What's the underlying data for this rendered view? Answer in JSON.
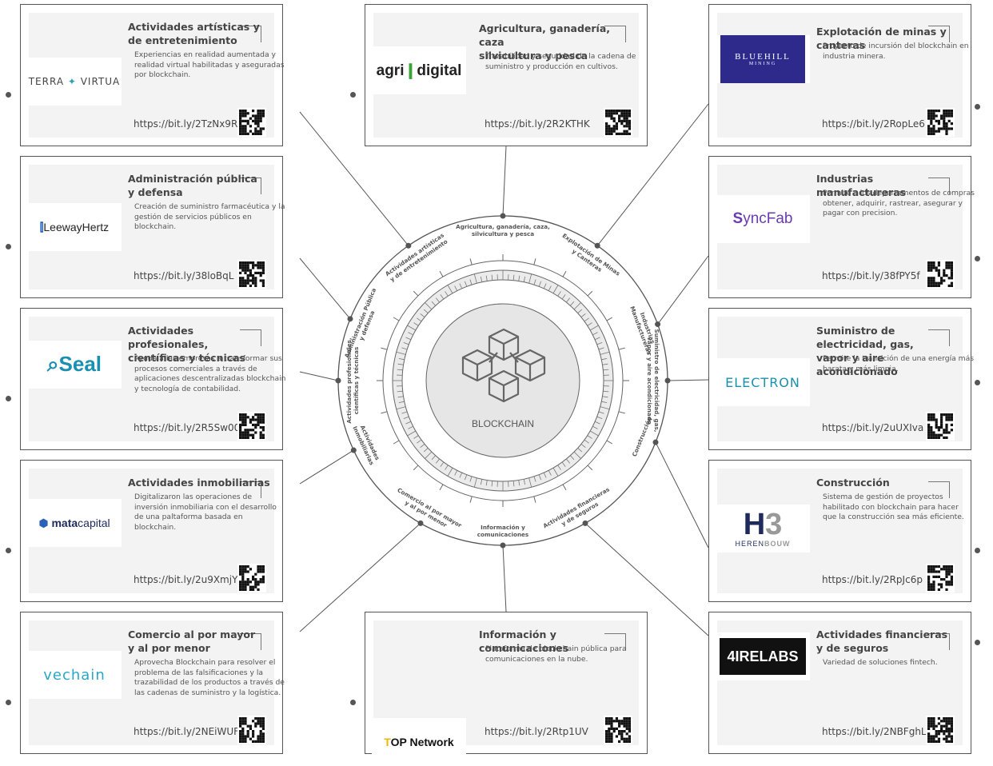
{
  "center": {
    "label": "BLOCKCHAIN"
  },
  "sectors": [
    {
      "title": "Actividades artísticas y de entretenimiento",
      "company": "TERRA VIRTUA",
      "desc": "Experiencias en realidad aumentada y realidad virtual habilitadas y aseguradas por blockchain.",
      "url": "https://bit.ly/2TzNx9R",
      "ring": "Actividades artísticas y de entretenimiento"
    },
    {
      "title": "Agricultura, ganadería, caza silvicultura y pesca",
      "company": "agri digital",
      "desc": "Trazabilidad y seguridad de la cadena de suministro y producción en cultivos.",
      "url": "https://bit.ly/2R2KTHK",
      "ring": "Agricultura, ganadería, caza, silvicultura y pesca"
    },
    {
      "title": "Explotación de minas y canteras",
      "company": "BLUEHILL MINING",
      "desc": "Proyecto de incursión del blockchain en industria minera.",
      "url": "https://bit.ly/2RopLe6",
      "ring": "Explotación de Minas y Canteras"
    },
    {
      "title": "Administración pública y defensa",
      "company": "LeewayHertz",
      "desc": "Creación de suministro farmacéutica y la gestión de servicios públicos en blockchain.",
      "url": "https://bit.ly/38loBqL",
      "ring": "Administración Pública y defensa"
    },
    {
      "title": "Industrias manufactureras",
      "company": "SyncFab",
      "desc": "Permite a los departamentos de compras obtener, adquirir, rastrear, asegurar y pagar con precision.",
      "url": "https://bit.ly/38fPY5f",
      "ring": "Industrias Manufactureras"
    },
    {
      "title": "Actividades profesionales, científicas y técnicas",
      "company": "Seal",
      "desc": "Ayuda a las empresas a transformar sus procesos comerciales a través de aplicaciones descentralizadas blockchain y tecnología de contabilidad.",
      "url": "https://bit.ly/2R5Sw00",
      "ring": "Actividades profesionales, científicas y técnicas"
    },
    {
      "title": "Suministro de electricidad, gas, vapor y aire acondicionado",
      "company": "ELECTRON",
      "desc": "Permite la transición de una energía más barata y más limpia.",
      "url": "https://bit.ly/2uUXIva",
      "ring": "Suministro de electricidad, gas, vapor y aire acondicionado"
    },
    {
      "title": "Actividades inmobiliarias",
      "company": "matacapital",
      "desc": "Digitalizaron las operaciones de inversión inmobiliaria con el desarrollo de una paltaforma basada en blockchain.",
      "url": "https://bit.ly/2u9XmjY",
      "ring": "Actividades Inmobiliarias"
    },
    {
      "title": "Construcción",
      "company": "HERENBOUW",
      "desc": "Sistema de gestión de proyectos habilitado con blockchain para hacer que la construcción sea más eficiente.",
      "url": "https://bit.ly/2RpJc6p",
      "ring": "Construcción"
    },
    {
      "title": "Comercio al por mayor y al por menor",
      "company": "vechain",
      "desc": "Aprovecha Blockchain para resolver el problema de las falsificaciones y la trazabilidad de los productos a través de las cadenas de suministro y la logística.",
      "url": "https://bit.ly/2NEiWUF",
      "ring": "Comercio al por mayor y al por menor"
    },
    {
      "title": "Información y comunicaciones",
      "company": "TOP Network",
      "desc": "Plataforma de blockchain pública para comunicaciones en la nube.",
      "url": "https://bit.ly/2Rtp1UV",
      "ring": "Información y comunicaciones"
    },
    {
      "title": "Actividades financieras y de seguros",
      "company": "4IRELABS",
      "desc": "Variedad de soluciones fintech.",
      "url": "https://bit.ly/2NBFghL",
      "ring": "Actividades financieras y de seguros"
    }
  ],
  "titles_split": {
    "t0": [
      "Actividades artísticas y",
      "de entretenimiento"
    ],
    "t1": [
      "Agricultura, ganadería, caza",
      "silvicultura y pesca"
    ],
    "t2": [
      "Explotación de minas y canteras"
    ],
    "t3": [
      "Administración pública",
      "y defensa"
    ],
    "t4": [
      "Industrias manufactureras"
    ],
    "t5": [
      "Actividades profesionales,",
      "científicas y técnicas"
    ],
    "t6": [
      "Suministro de electricidad, gas,",
      "vapor y aire acondicionado"
    ],
    "t7": [
      "Actividades inmobiliarias"
    ],
    "t8": [
      "Construcción"
    ],
    "t9": [
      "Comercio al por mayor",
      "y al por menor"
    ],
    "t10": [
      "Información y comunicaciones"
    ],
    "t11": [
      "Actividades financieras",
      "y de seguros"
    ]
  },
  "colors": {
    "bluehill": "#2d2a8c",
    "seal": "#1a8fb0",
    "electron": "#1a8fb0",
    "herenbouw": "#1f2a5c",
    "firelabs": "#111111",
    "syncfab": "#6a3bb0",
    "agri_green": "#3aa335"
  }
}
